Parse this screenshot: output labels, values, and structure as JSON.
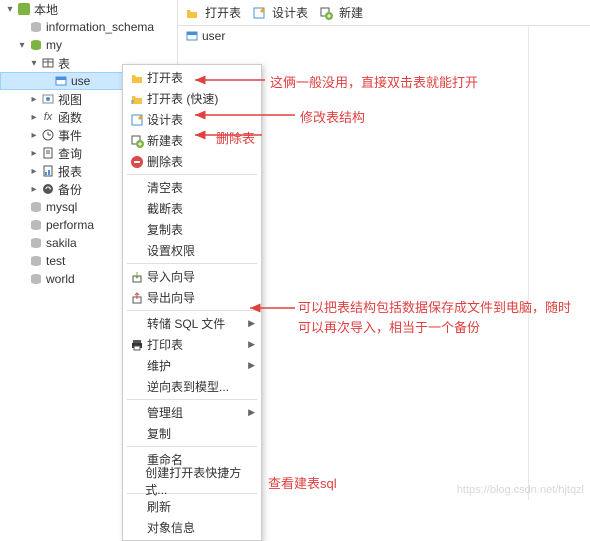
{
  "sidebar": {
    "root": "本地",
    "items": [
      {
        "label": "information_schema",
        "icon": "db"
      },
      {
        "label": "my",
        "icon": "db-active"
      }
    ],
    "my_children": {
      "tables_label": "表",
      "user_table": "use",
      "nodes": [
        {
          "label": "视图",
          "icon": "view"
        },
        {
          "label": "函数",
          "icon": "fx"
        },
        {
          "label": "事件",
          "icon": "event"
        },
        {
          "label": "查询",
          "icon": "query"
        },
        {
          "label": "报表",
          "icon": "report"
        },
        {
          "label": "备份",
          "icon": "backup"
        }
      ]
    },
    "other_dbs": [
      "mysql",
      "performa",
      "sakila",
      "test",
      "world"
    ]
  },
  "toolbar": {
    "open": "打开表",
    "design": "设计表",
    "new": "新建"
  },
  "content": {
    "user_row": "user"
  },
  "menu": {
    "items": [
      {
        "label": "打开表",
        "icon": "open"
      },
      {
        "label": "打开表 (快速)",
        "icon": "open-fast"
      },
      {
        "label": "设计表",
        "icon": "design"
      },
      {
        "label": "新建表",
        "icon": "new"
      },
      {
        "label": "删除表",
        "icon": "delete"
      },
      {
        "sep": true
      },
      {
        "label": "清空表"
      },
      {
        "label": "截断表"
      },
      {
        "label": "复制表"
      },
      {
        "label": "设置权限"
      },
      {
        "sep": true
      },
      {
        "label": "导入向导",
        "icon": "import"
      },
      {
        "label": "导出向导",
        "icon": "export"
      },
      {
        "sep": true
      },
      {
        "label": "转储 SQL 文件",
        "submenu": true
      },
      {
        "label": "打印表",
        "icon": "print",
        "submenu": true
      },
      {
        "label": "维护",
        "submenu": true
      },
      {
        "label": "逆向表到模型..."
      },
      {
        "sep": true
      },
      {
        "label": "管理组",
        "submenu": true
      },
      {
        "label": "复制"
      },
      {
        "sep": true
      },
      {
        "label": "重命名"
      },
      {
        "label": "创建打开表快捷方式..."
      },
      {
        "sep": true
      },
      {
        "label": "刷新"
      },
      {
        "label": "对象信息"
      }
    ]
  },
  "annotations": {
    "a1": "这俩一般没用，直接双击表就能打开",
    "a2": "修改表结构",
    "a3": "删除表",
    "a4": "可以把表结构包括数据保存成文件到电脑，随时可以再次导入，相当于一个备份",
    "a5": "查看建表sql"
  },
  "watermark": "https://blog.csdn.net/hjtqzl"
}
